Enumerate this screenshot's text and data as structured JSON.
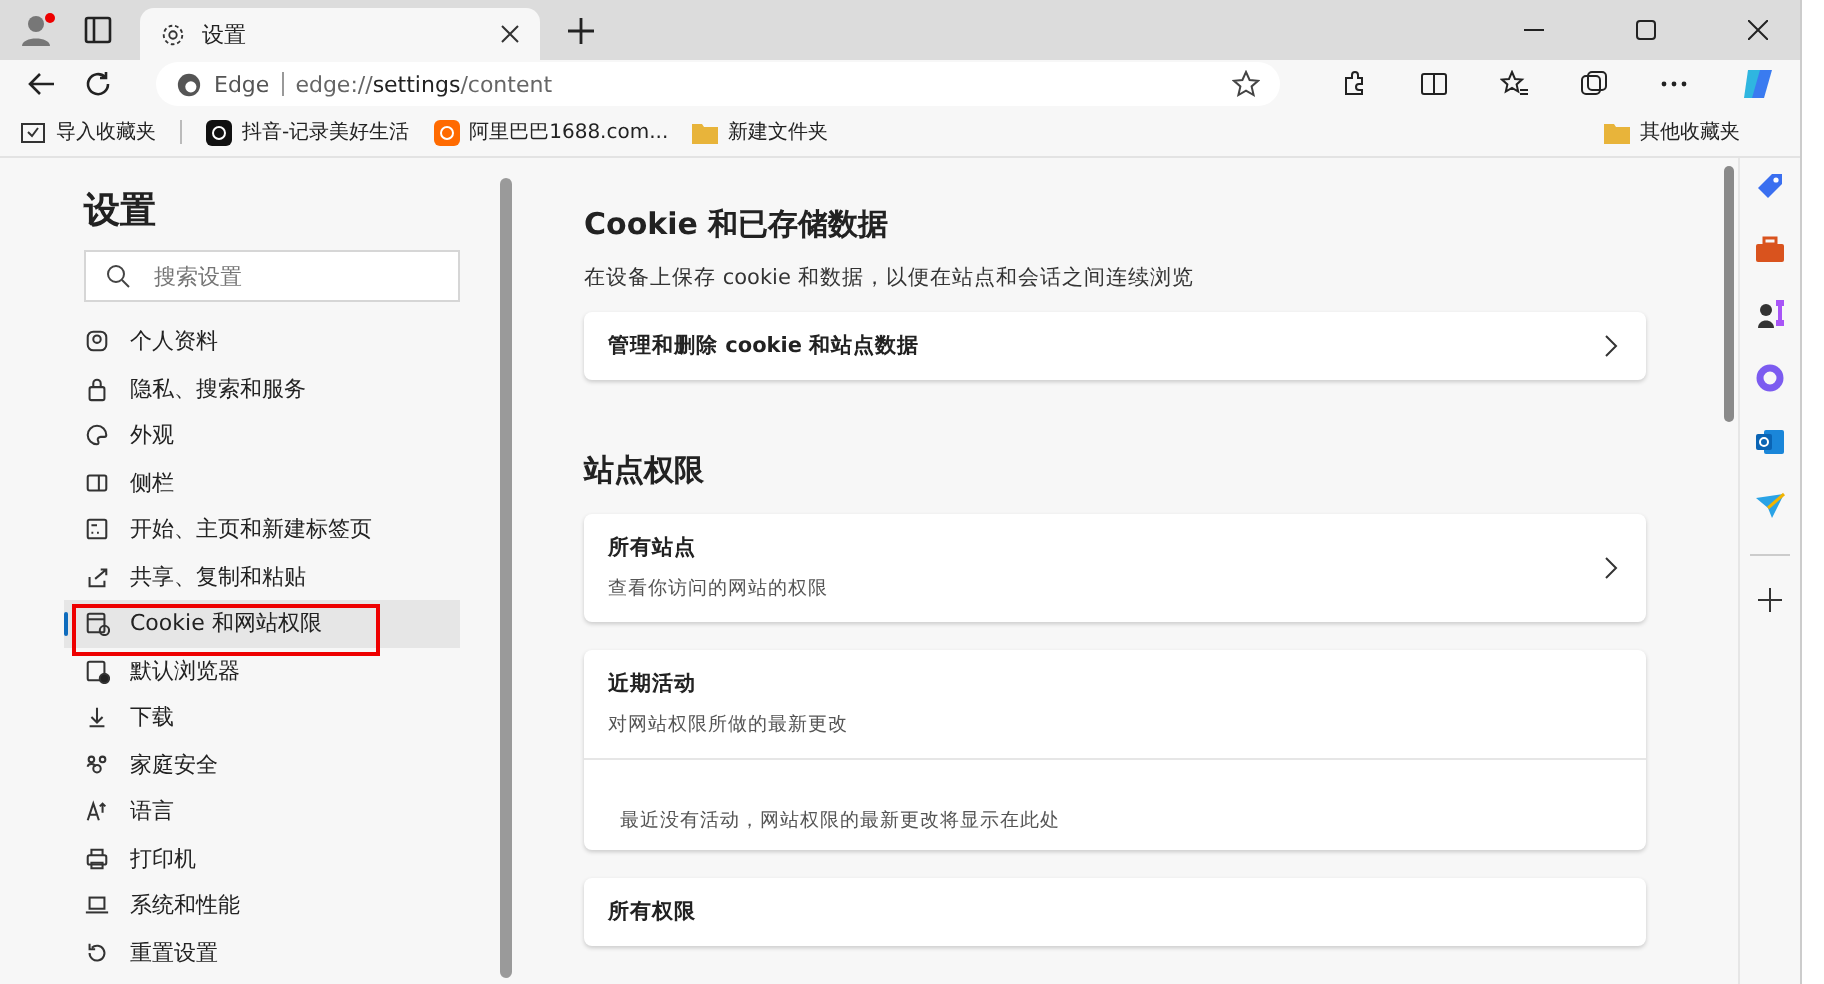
{
  "tab": {
    "title": "设置"
  },
  "address": {
    "brand": "Edge",
    "url_prefix": "edge://",
    "url_host": "settings",
    "url_path": "/content"
  },
  "bookmarks": [
    {
      "label": "导入收藏夹",
      "kind": "import"
    },
    {
      "label": "抖音-记录美好生活",
      "kind": "app"
    },
    {
      "label": "阿里巴巴1688.com...",
      "kind": "shop"
    },
    {
      "label": "新建文件夹",
      "kind": "folder"
    }
  ],
  "other_bookmarks": {
    "label": "其他收藏夹"
  },
  "sidebar": {
    "title": "设置",
    "search": {
      "placeholder": "搜索设置"
    },
    "items": [
      {
        "label": "个人资料",
        "kind": "profile",
        "selected": false
      },
      {
        "label": "隐私、搜索和服务",
        "kind": "lock",
        "selected": false
      },
      {
        "label": "外观",
        "kind": "palette",
        "selected": false
      },
      {
        "label": "侧栏",
        "kind": "panel",
        "selected": false
      },
      {
        "label": "开始、主页和新建标签页",
        "kind": "home",
        "selected": false
      },
      {
        "label": "共享、复制和粘贴",
        "kind": "share",
        "selected": false
      },
      {
        "label": "Cookie 和网站权限",
        "kind": "cookie",
        "selected": true
      },
      {
        "label": "默认浏览器",
        "kind": "browser",
        "selected": false
      },
      {
        "label": "下载",
        "kind": "download",
        "selected": false
      },
      {
        "label": "家庭安全",
        "kind": "family",
        "selected": false
      },
      {
        "label": "语言",
        "kind": "language",
        "selected": false
      },
      {
        "label": "打印机",
        "kind": "printer",
        "selected": false
      },
      {
        "label": "系统和性能",
        "kind": "laptop",
        "selected": false
      },
      {
        "label": "重置设置",
        "kind": "reset",
        "selected": false
      }
    ]
  },
  "sections": [
    {
      "heading": "Cookie 和已存储数据",
      "description": "在设备上保存 cookie 和数据，以便在站点和会话之间连续浏览",
      "cards": [
        {
          "title": "管理和删除 cookie 和站点数据",
          "arrow": true
        }
      ]
    },
    {
      "heading": "站点权限",
      "cards": [
        {
          "title": "所有站点",
          "subtitle": "查看你访问的网站的权限",
          "arrow": true
        },
        {
          "title": "近期活动",
          "subtitle": "对网站权限所做的最新更改",
          "empty_message": "最近没有活动，网站权限的最新更改将显示在此处",
          "arrow": false
        },
        {
          "title": "所有权限",
          "arrow": false
        }
      ]
    }
  ]
}
